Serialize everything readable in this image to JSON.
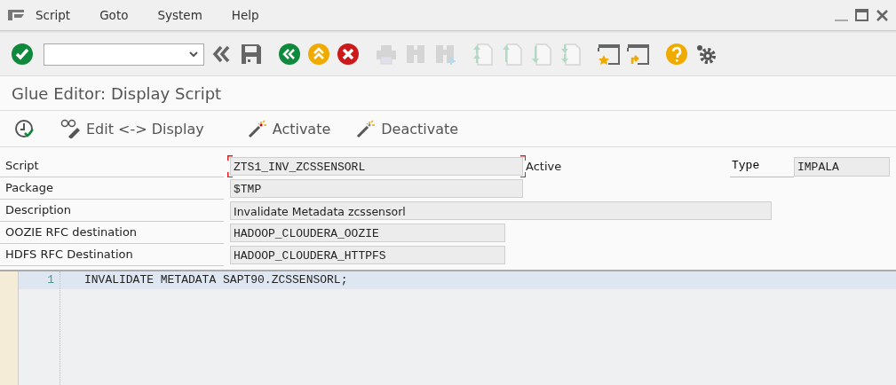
{
  "menu": [
    {
      "label": "Script"
    },
    {
      "label": "Goto"
    },
    {
      "label": "System"
    },
    {
      "label": "Help"
    }
  ],
  "toolbar": [
    {
      "kind": "enter",
      "disabled": false
    },
    {
      "kind": "command-field"
    },
    {
      "kind": "collapse",
      "disabled": false
    },
    {
      "kind": "save",
      "disabled": false
    },
    {
      "kind": "back",
      "disabled": false
    },
    {
      "kind": "exit",
      "disabled": false
    },
    {
      "kind": "cancel",
      "disabled": false
    },
    {
      "kind": "print",
      "disabled": true
    },
    {
      "kind": "find",
      "disabled": true
    },
    {
      "kind": "find-next",
      "disabled": true
    },
    {
      "kind": "first-page",
      "disabled": true
    },
    {
      "kind": "previous-page",
      "disabled": true
    },
    {
      "kind": "next-page",
      "disabled": true
    },
    {
      "kind": "last-page",
      "disabled": true
    },
    {
      "kind": "new-session",
      "disabled": false
    },
    {
      "kind": "shortcut",
      "disabled": false
    },
    {
      "kind": "help",
      "disabled": false
    },
    {
      "kind": "settings",
      "disabled": false
    }
  ],
  "window": {
    "title": "Glue Editor: Display Script"
  },
  "app_toolbar": [
    {
      "kind": "check"
    },
    {
      "kind": "toggle",
      "label": "Edit <-> Display"
    },
    {
      "kind": "activate",
      "label": "Activate"
    },
    {
      "kind": "deactivate",
      "label": "Deactivate"
    }
  ],
  "form": [
    {
      "label": "Script",
      "value": "ZTS1_INV_ZCSSENSORL",
      "mono": true,
      "focused": true,
      "status": "Active",
      "type_label": "Type",
      "type_value": "IMPALA"
    },
    {
      "label": "Package",
      "value": "$TMP",
      "mono": true,
      "focused": false
    },
    {
      "label": "Description",
      "value": "Invalidate Metadata zcssensorl",
      "mono": false,
      "focused": false
    },
    {
      "label": "OOZIE RFC destination",
      "value": "HADOOP_CLOUDERA_OOZIE",
      "mono": true,
      "focused": false
    },
    {
      "label": "HDFS RFC Destination",
      "value": "HADOOP_CLOUDERA_HTTPFS",
      "mono": true,
      "focused": false
    }
  ],
  "editor": {
    "lines": [
      {
        "number": "1",
        "code": "INVALIDATE METADATA SAPT90.ZCSSENSORL;",
        "current": true
      }
    ]
  }
}
